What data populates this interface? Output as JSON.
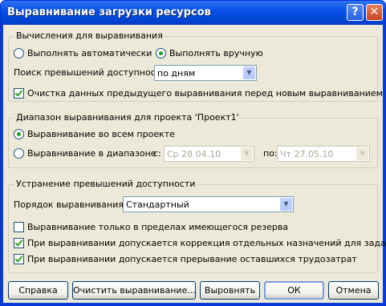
{
  "window": {
    "title": "Выравнивание загрузки ресурсов",
    "help_glyph": "?",
    "close_glyph": "✕"
  },
  "calc": {
    "legend": "Вычисления для выравнивания",
    "auto_label": "Выполнять автоматически",
    "manual_label": "Выполнять вручную",
    "search_label": "Поиск превышений доступности:",
    "search_value": "по дням",
    "clear_label": "Очистка данных предыдущего выравнивания перед новым выравниванием"
  },
  "range": {
    "legend": "Диапазон выравнивания для проекта 'Проект1'",
    "all_label": "Выравнивание во всем проекте",
    "range_label": "Выравнивание в диапазоне",
    "from_label": "с:",
    "from_value": "Ср 28.04.10",
    "to_label": "по:",
    "to_value": "Чт 27.05.10"
  },
  "resolve": {
    "legend": "Устранение превышений доступности",
    "order_label": "Порядок выравнивания:",
    "order_value": "Стандартный",
    "slack_label": "Выравнивание только в пределах имеющегося резерва",
    "adjust_label": "При выравнивании допускается коррекция отдельных назначений для задачи",
    "split_label": "При выравнивании допускается прерывание оставшихся трудозатрат"
  },
  "buttons": {
    "help": "Справка",
    "clear": "Очистить выравнивание...",
    "level": "Выровнять",
    "ok": "ОК",
    "cancel": "Отмена"
  },
  "icons": {
    "dropdown_arrow": "▼"
  }
}
